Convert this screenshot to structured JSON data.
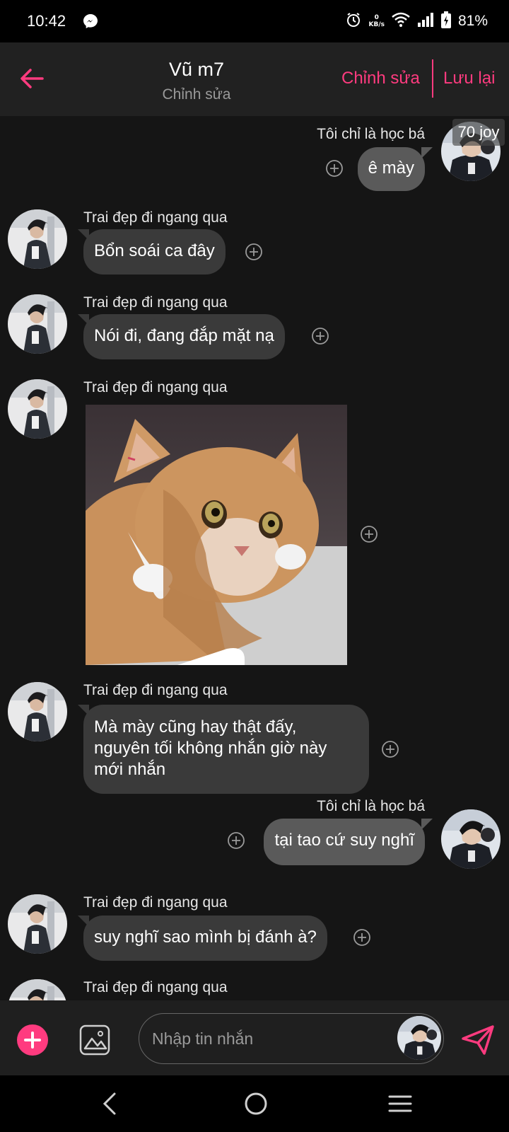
{
  "status_bar": {
    "time": "10:42",
    "net_speed_value": "0",
    "net_speed_unit": "KB/s",
    "battery": "81%"
  },
  "header": {
    "title": "Vũ m7",
    "subtitle": "Chỉnh sửa",
    "edit_label": "Chỉnh sửa",
    "save_label": "Lưu lại"
  },
  "badge": "70 joy",
  "messages": [
    {
      "sender": "Tôi chỉ là học bá",
      "text": "ê mày",
      "side": "right"
    },
    {
      "sender": "Trai đẹp đi ngang qua",
      "text": "Bổn soái ca đây",
      "side": "left"
    },
    {
      "sender": "Trai đẹp đi ngang qua",
      "text": "Nói đi, đang đắp mặt nạ",
      "side": "left"
    },
    {
      "sender": "Trai đẹp đi ngang qua",
      "text": "",
      "side": "left",
      "type": "image"
    },
    {
      "sender": "Trai đẹp đi ngang qua",
      "lines": [
        "Mà mày cũng hay thật đấy,",
        "nguyên tối không nhắn giờ này",
        "mới nhắn"
      ],
      "side": "left"
    },
    {
      "sender": "Tôi chỉ là học bá",
      "text": "tại tao cứ suy nghĩ",
      "side": "right"
    },
    {
      "sender": "Trai đẹp đi ngang qua",
      "text": "suy nghĩ sao mình bị đánh à?",
      "side": "left"
    },
    {
      "sender": "Trai đẹp đi ngang qua",
      "text": "",
      "side": "left"
    }
  ],
  "composer": {
    "placeholder": "Nhập tin nhắn"
  },
  "colors": {
    "accent": "#ff3b7f",
    "bubble_left": "#3a3a3a",
    "bubble_right": "#5a5a5a",
    "background": "#151515"
  },
  "icons": [
    "messenger-icon",
    "alarm-icon",
    "wifi-icon",
    "signal-icon",
    "battery-icon",
    "back-arrow-icon",
    "add-reaction-icon",
    "add-icon",
    "gallery-icon",
    "send-icon",
    "nav-back-icon",
    "nav-home-icon",
    "nav-recents-icon"
  ]
}
